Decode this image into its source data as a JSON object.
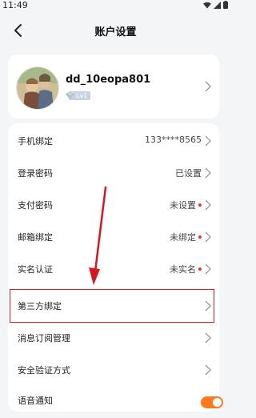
{
  "status_bar": {
    "time": "11:49"
  },
  "nav": {
    "title": "账户设置"
  },
  "profile": {
    "username": "dd_10eopa801",
    "level": "Lv1"
  },
  "settings": {
    "phone": {
      "label": "手机绑定",
      "value": "133****8565"
    },
    "login_password": {
      "label": "登录密码",
      "value": "已设置"
    },
    "pay_password": {
      "label": "支付密码",
      "value": "未设置"
    },
    "email": {
      "label": "邮箱绑定",
      "value": "未绑定"
    },
    "real_name": {
      "label": "实名认证",
      "value": "未实名"
    },
    "third_party": {
      "label": "第三方绑定"
    },
    "subscription": {
      "label": "消息订阅管理"
    },
    "security": {
      "label": "安全验证方式"
    },
    "voice": {
      "label": "语音通知",
      "enabled": true
    }
  },
  "colors": {
    "accent_orange": "#ff7a1f",
    "highlight_red": "#e11d2a",
    "dot_red": "#e53935"
  }
}
